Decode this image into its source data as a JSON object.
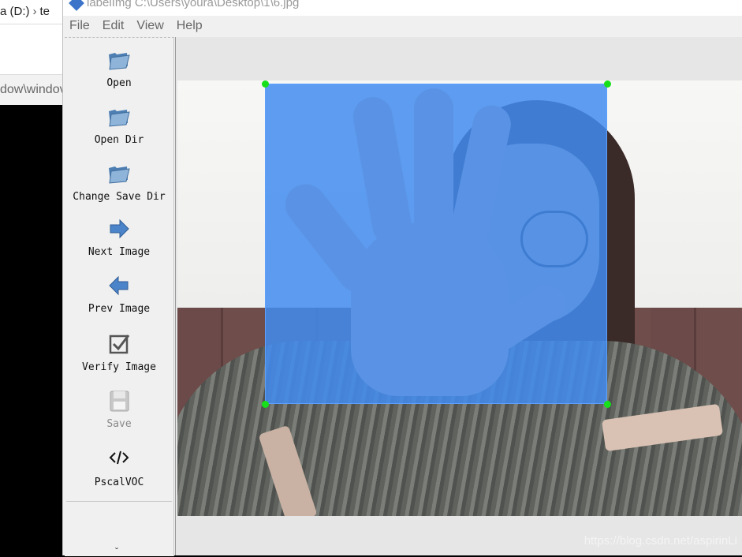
{
  "background_window": {
    "address_drive": "a (D:)",
    "address_next": "te",
    "path_text": "dow\\windov"
  },
  "window": {
    "title": "labelImg C:\\Users\\youra\\Desktop\\1\\6.jpg"
  },
  "menu": [
    "File",
    "Edit",
    "View",
    "Help"
  ],
  "toolbar": {
    "tools": [
      {
        "label": "Open",
        "icon": "folder-open-icon"
      },
      {
        "label": "Open Dir",
        "icon": "folder-open-icon"
      },
      {
        "label": "Change Save Dir",
        "icon": "folder-open-icon"
      },
      {
        "label": "Next Image",
        "icon": "arrow-right-icon"
      },
      {
        "label": "Prev Image",
        "icon": "arrow-left-icon"
      },
      {
        "label": "Verify Image",
        "icon": "checkbox-check-icon"
      },
      {
        "label": "Save",
        "icon": "floppy-disk-icon",
        "enabled": false
      },
      {
        "label": "PscalVOC",
        "icon": "code-tag-icon"
      }
    ],
    "more_glyph": "ˇ"
  },
  "canvas": {
    "bbox_color": "#428CF0",
    "handle_color": "#17E01A"
  },
  "watermark": "https://blog.csdn.net/aspirinLi"
}
